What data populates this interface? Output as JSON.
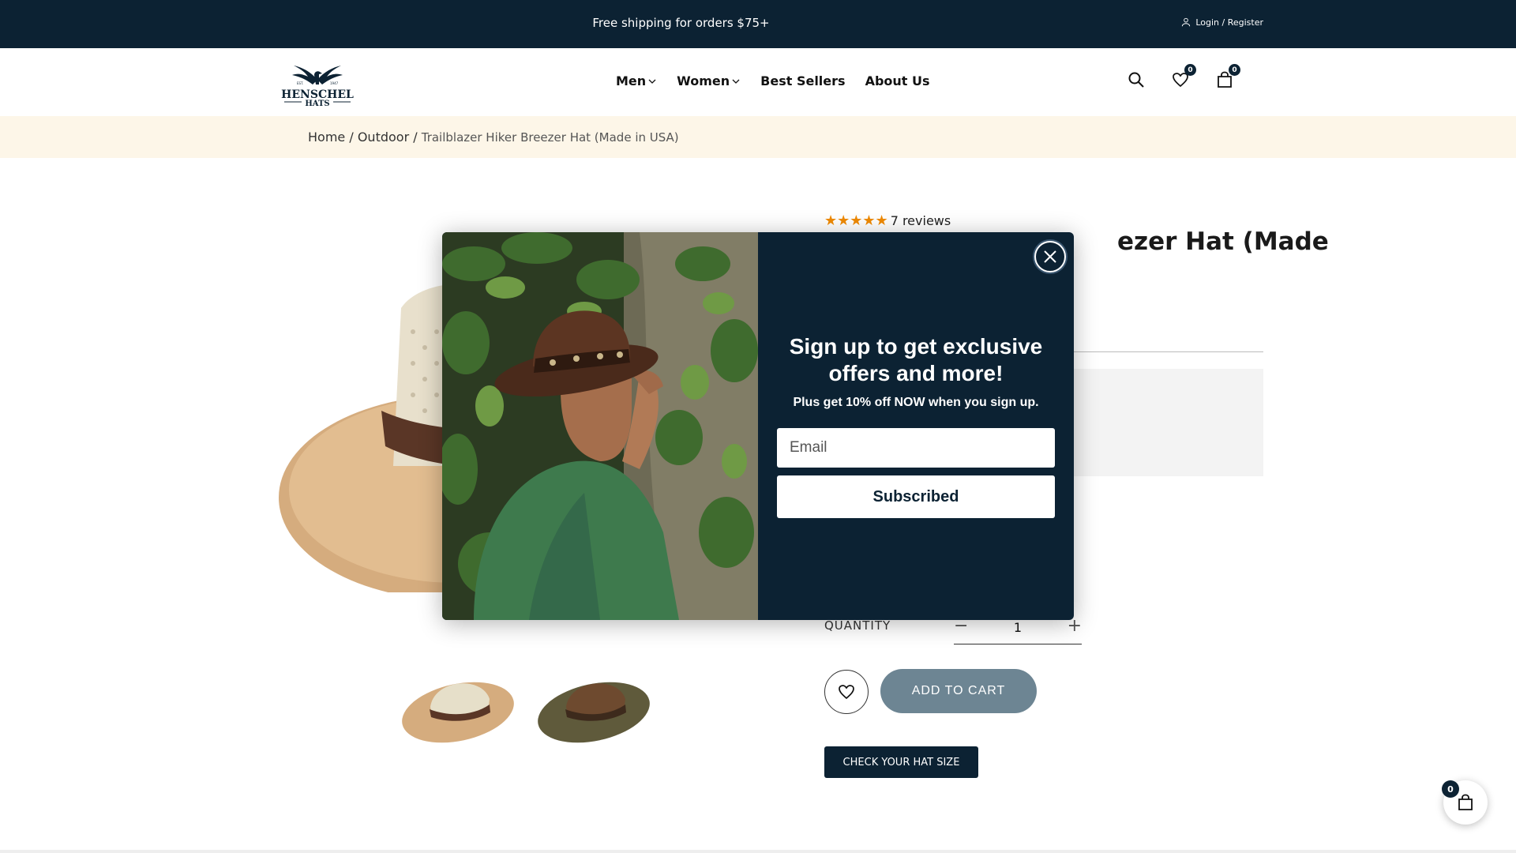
{
  "topbar": {
    "promo": "Free shipping for orders $75+",
    "login": "Login / Register"
  },
  "header": {
    "logo_text": "HENSCHEL",
    "logo_sub": "HATS",
    "logo_est": "EST.",
    "logo_year": "1947",
    "nav": [
      {
        "label": "Men",
        "dropdown": true
      },
      {
        "label": "Women",
        "dropdown": true
      },
      {
        "label": "Best Sellers",
        "dropdown": false
      },
      {
        "label": "About Us",
        "dropdown": false
      }
    ],
    "wishlist_count": "0",
    "cart_count": "0"
  },
  "breadcrumb": {
    "home": "Home",
    "sep": "/",
    "category": "Outdoor",
    "current": "Trailblazer Hiker Breezer Hat (Made in USA)"
  },
  "product": {
    "reviews": "7 reviews",
    "title_visible": "ezer Hat (Made",
    "quantity_label": "QUANTITY",
    "quantity_value": "1",
    "add_to_cart": "ADD TO CART",
    "size_button": "CHECK YOUR HAT SIZE",
    "stars": "★★★★★"
  },
  "popup": {
    "heading_line1": "Sign up to get exclusive",
    "heading_line2": "offers and more!",
    "subtext": "Plus get 10% off NOW when you sign up.",
    "email_placeholder": "Email",
    "submit_label": "Subscribed"
  },
  "floating_cart": {
    "count": "0"
  },
  "colors": {
    "navy": "#0c2233",
    "cream": "#fdf6e8",
    "star": "#f08a00",
    "atc": "#6d8593"
  },
  "icons": [
    "user-icon",
    "chevron-down-icon",
    "search-icon",
    "heart-icon",
    "bag-icon",
    "close-icon",
    "minus-icon",
    "plus-icon",
    "eagle-logo"
  ]
}
